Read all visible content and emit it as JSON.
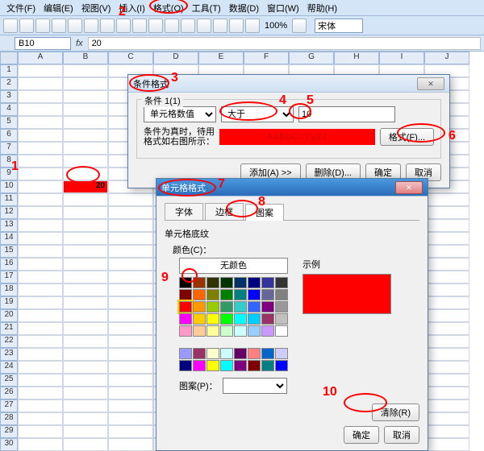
{
  "menu": [
    "文件(F)",
    "编辑(E)",
    "视图(V)",
    "插入(I)",
    "格式(O)",
    "工具(T)",
    "数据(D)",
    "窗口(W)",
    "帮助(H)"
  ],
  "zoom": "100%",
  "font": "宋体",
  "namebox": "B10",
  "formula": "20",
  "columns": [
    "A",
    "B",
    "C",
    "D",
    "E",
    "F",
    "G",
    "H",
    "I",
    "J"
  ],
  "rows_count": 30,
  "selected_cell": {
    "row": 10,
    "col": 1,
    "value": "20"
  },
  "dlg_cond": {
    "title": "条件格式",
    "legend": "条件 1(1)",
    "type_options": [
      "单元格数值"
    ],
    "type_value": "单元格数值",
    "op_options": [
      "大于"
    ],
    "op_value": "大于",
    "value": "10",
    "hint1": "条件为真时，待用",
    "hint2": "格式如右图所示：",
    "preview": "AaBbCcYyZz",
    "btn_format": "格式(F)...",
    "btn_add": "添加(A) >>",
    "btn_del": "删除(D)...",
    "btn_ok": "确定",
    "btn_cancel": "取消"
  },
  "dlg_fmt": {
    "title": "单元格格式",
    "tab_font": "字体",
    "tab_border": "边框",
    "tab_pattern": "图案",
    "shading_label": "单元格底纹",
    "color_label": "颜色(C)：",
    "nocolor": "无颜色",
    "pattern_label": "图案(P)：",
    "sample_label": "示例",
    "btn_clear": "清除(R)",
    "btn_ok": "确定",
    "btn_cancel": "取消"
  },
  "palette_main": [
    "#000000",
    "#993300",
    "#333300",
    "#003300",
    "#003366",
    "#000080",
    "#333399",
    "#333333",
    "#800000",
    "#ff6600",
    "#808000",
    "#008000",
    "#008080",
    "#0000ff",
    "#666699",
    "#808080",
    "#ff0000",
    "#ff9900",
    "#99cc00",
    "#339966",
    "#33cccc",
    "#3366ff",
    "#800080",
    "#999999",
    "#ff00ff",
    "#ffcc00",
    "#ffff00",
    "#00ff00",
    "#00ffff",
    "#00ccff",
    "#993366",
    "#c0c0c0",
    "#ff99cc",
    "#ffcc99",
    "#ffff99",
    "#ccffcc",
    "#ccffff",
    "#99ccff",
    "#cc99ff",
    "#ffffff"
  ],
  "palette_ext": [
    "#9999ff",
    "#993366",
    "#ffffcc",
    "#ccffff",
    "#660066",
    "#ff8080",
    "#0066cc",
    "#ccccff",
    "#000080",
    "#ff00ff",
    "#ffff00",
    "#00ffff",
    "#800080",
    "#800000",
    "#008080",
    "#0000ff"
  ],
  "marks": [
    "1",
    "2",
    "3",
    "4",
    "5",
    "6",
    "7",
    "8",
    "9",
    "10"
  ]
}
